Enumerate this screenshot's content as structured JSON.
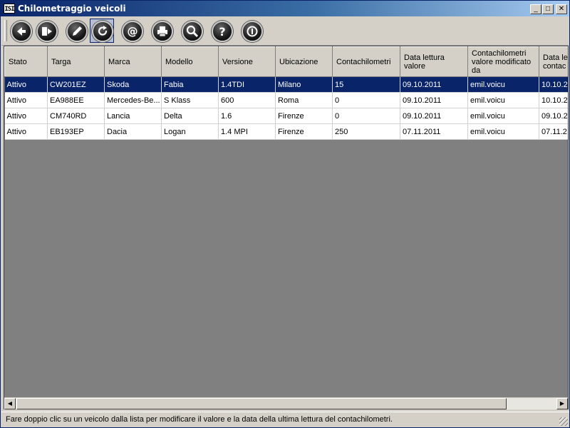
{
  "window": {
    "icon_text": "ISI",
    "title": "Chilometraggio veicoli",
    "controls": {
      "minimize": "_",
      "maximize": "□",
      "close": "✕"
    }
  },
  "toolbar": {
    "buttons": [
      {
        "name": "back-button",
        "icon": "arrow-left-icon"
      },
      {
        "name": "exit-button",
        "icon": "exit-door-icon"
      },
      {
        "name": "edit-button",
        "icon": "pencil-icon"
      },
      {
        "name": "refresh-button",
        "icon": "refresh-icon",
        "active": true
      },
      {
        "name": "email-button",
        "icon": "at-sign-icon"
      },
      {
        "name": "print-button",
        "icon": "printer-icon"
      },
      {
        "name": "search-button",
        "icon": "magnifier-icon"
      },
      {
        "name": "help-button",
        "icon": "question-icon"
      },
      {
        "name": "info-button",
        "icon": "info-icon"
      }
    ]
  },
  "grid": {
    "columns": [
      "Stato",
      "Targa",
      "Marca",
      "Modello",
      "Versione",
      "Ubicazione",
      "Contachilometri",
      "Data lettura valore",
      "Contachilometri valore modificato da",
      "Data le contac"
    ],
    "rows": [
      [
        "Attivo",
        "CW201EZ",
        "Skoda",
        "Fabia",
        "1.4TDI",
        "Milano",
        "15",
        "09.10.2011",
        "emil.voicu",
        "10.10.2"
      ],
      [
        "Attivo",
        "EA988EE",
        "Mercedes-Be...",
        "S Klass",
        "600",
        "Roma",
        "0",
        "09.10.2011",
        "emil.voicu",
        "10.10.2"
      ],
      [
        "Attivo",
        "CM740RD",
        "Lancia",
        "Delta",
        "1.6",
        "Firenze",
        "0",
        "09.10.2011",
        "emil.voicu",
        "09.10.2"
      ],
      [
        "Attivo",
        "EB193EP",
        "Dacia",
        "Logan",
        "1.4 MPI",
        "Firenze",
        "250",
        "07.11.2011",
        "emil.voicu",
        "07.11.2"
      ]
    ],
    "selected_row": 0
  },
  "scrollbar": {
    "left_arrow": "◀",
    "right_arrow": "▶"
  },
  "status": {
    "text": "Fare doppio clic su un veicolo dalla lista per modificare il valore e la data della ultima lettura del contachilometri."
  }
}
